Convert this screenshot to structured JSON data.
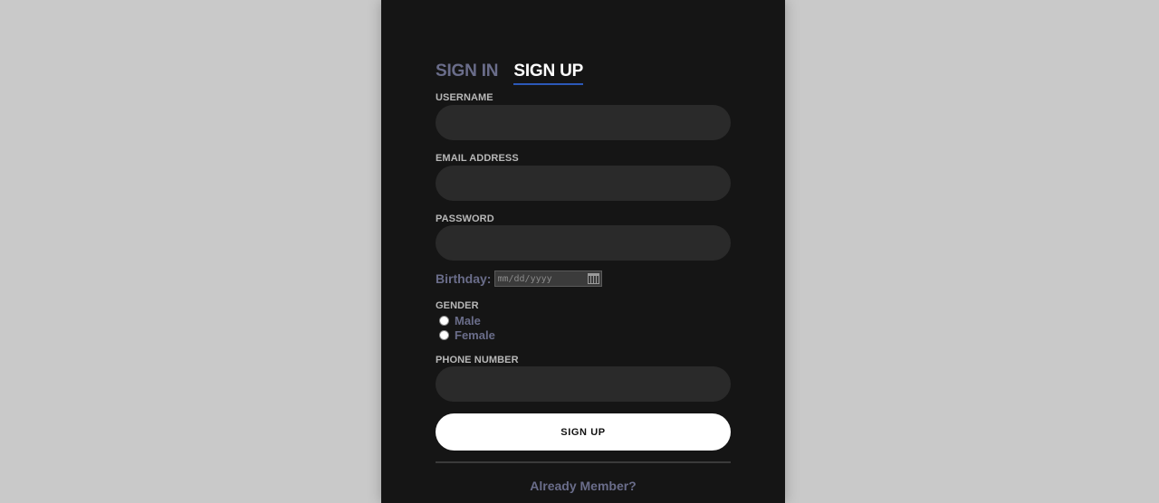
{
  "tabs": {
    "sign_in": "SIGN IN",
    "sign_up": "SIGN UP"
  },
  "form": {
    "username_label": "USERNAME",
    "username_value": "",
    "email_label": "EMAIL ADDRESS",
    "email_value": "",
    "password_label": "PASSWORD",
    "password_value": "",
    "birthday_label": "Birthday:",
    "birthday_placeholder": "mm/dd/yyyy",
    "gender_label": "GENDER",
    "gender_options": [
      "Male",
      "Female"
    ],
    "phone_label": "PHONE NUMBER",
    "phone_value": "",
    "submit_label": "SIGN UP"
  },
  "footer": {
    "member_link": "Already Member?"
  },
  "colors": {
    "background": "#c9c9c9",
    "panel": "#151515",
    "input_bg": "#2a2a2a",
    "muted_text": "#6a6d8a",
    "active_underline": "#2b58b8",
    "button_bg": "#ffffff"
  }
}
